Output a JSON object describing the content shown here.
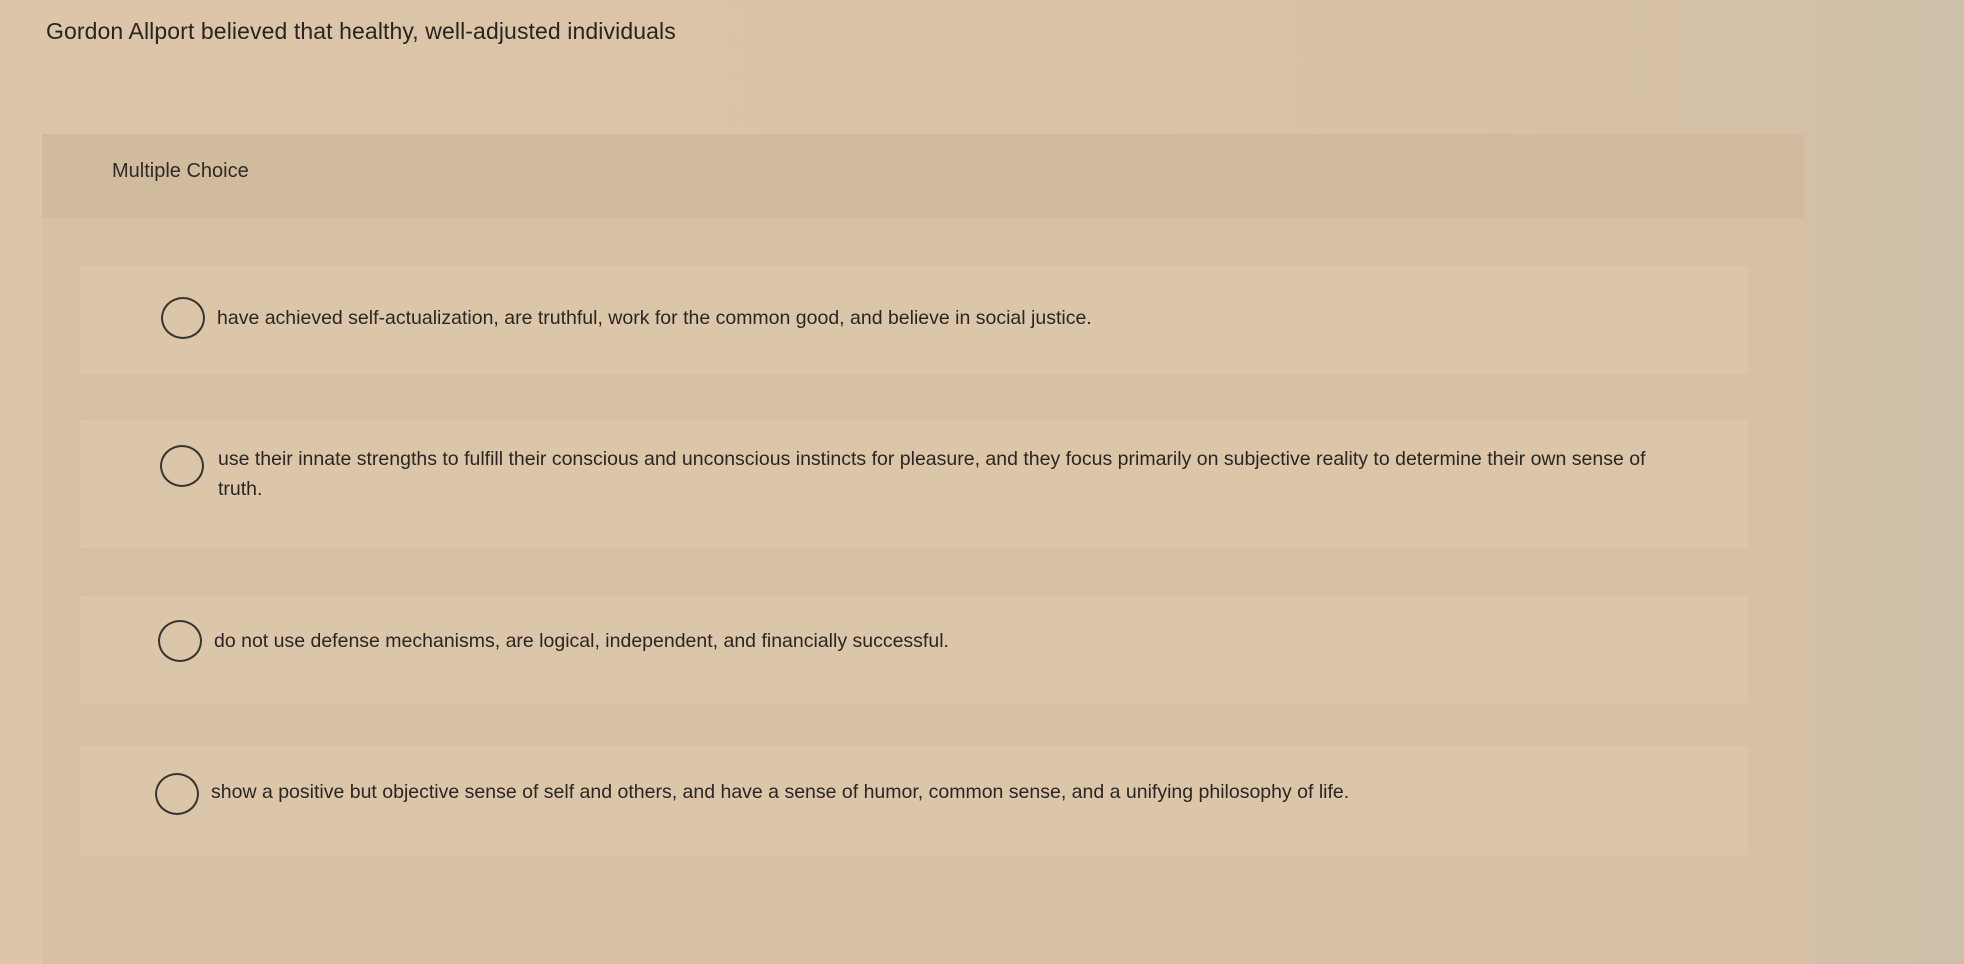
{
  "question": {
    "stem": "Gordon Allport believed that healthy, well-adjusted individuals"
  },
  "card": {
    "type_label": "Multiple Choice"
  },
  "options": [
    {
      "text": "have achieved self-actualization, are truthful, work for the common good, and believe in social justice.",
      "selected": false
    },
    {
      "text": "use their innate strengths to fulfill their conscious and unconscious instincts for pleasure, and they focus primarily on subjective reality to determine their own sense of truth.",
      "selected": false
    },
    {
      "text": "do not use defense mechanisms, are logical, independent, and financially successful.",
      "selected": false
    },
    {
      "text": "show a positive but objective sense of self and others, and have a sense of humor, common sense, and a unifying philosophy of life.",
      "selected": false
    }
  ],
  "colors": {
    "background": "#dcc5a8",
    "header": "#d1bb9e",
    "text": "#2b2622",
    "radio_border": "#3a342f"
  }
}
